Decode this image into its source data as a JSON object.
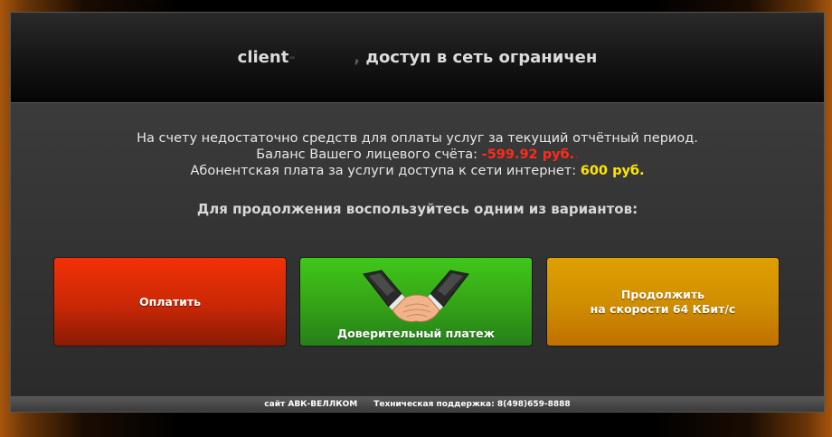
{
  "header": {
    "client_prefix": "client",
    "client_dash": "-",
    "client_comma": ",",
    "status_text": " доступ в сеть ограничен"
  },
  "message": {
    "line1": "На счету недостаточно средств для оплаты услуг за текущий отчётный период.",
    "line2_label": "Баланс Вашего лицевого счёта: ",
    "balance": "-599.92 руб.",
    "balance_trailing": ".",
    "line3_label": "Абонентская плата за услуги доступа к сети интернет: ",
    "fee": "600 руб.",
    "prompt": "Для продолжения воспользуйтесь одним из вариантов:"
  },
  "buttons": {
    "pay": "Оплатить",
    "trust": "Доверительный платеж",
    "slow_line1": "Продолжить",
    "slow_line2": "на скорости 64 КБит/с"
  },
  "footer": {
    "site": "сайт АВК-ВЕЛЛКОМ",
    "support": "Техническая поддержка: 8(498)659-8888"
  },
  "colors": {
    "pay": "#d42d06",
    "trust": "#36a516",
    "slow": "#d08f00",
    "negative": "#ff2a1a",
    "fee": "#ffe600"
  },
  "icons": {
    "trust_icon": "handshake-icon"
  }
}
